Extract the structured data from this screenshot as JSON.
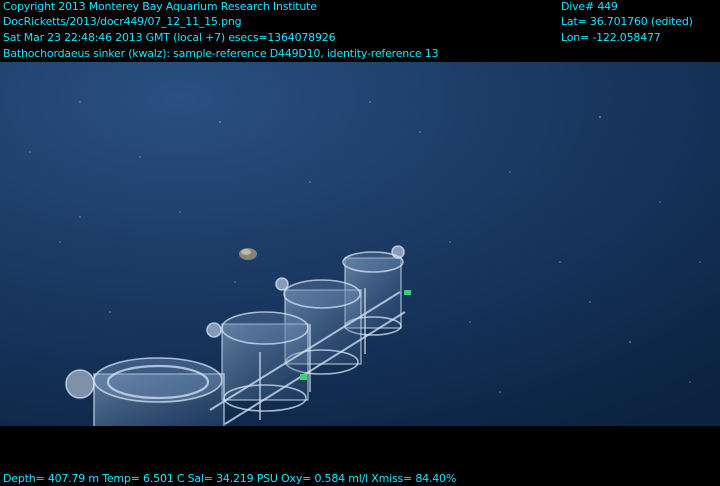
{
  "overlay": {
    "copyright": "Copyright 2013 Monterey Bay Aquarium Research Institute",
    "file": "DocRicketts/2013/docr449/07_12_11_15.png",
    "datetime": "Sat Mar 23 22:48:46 2013 GMT (local +7)  esecs=1364078926",
    "observation": "Bathochordaeus sinker (kwalz): sample-reference D449D10, identity-reference 13",
    "dive": "Dive# 449",
    "lat": "Lat= 36.701760 (edited)",
    "lon": "Lon= -122.058477",
    "sensors": "Depth= 407.79 m  Temp= 6.501 C  Sal= 34.219 PSU  Oxy= 0.584 ml/l  Xmiss= 84.40%"
  },
  "colors": {
    "overlay_text": "#14e6ff",
    "water_deep": "#0c2340",
    "water_mid": "#1b3d68",
    "letterbox": "#000000"
  }
}
